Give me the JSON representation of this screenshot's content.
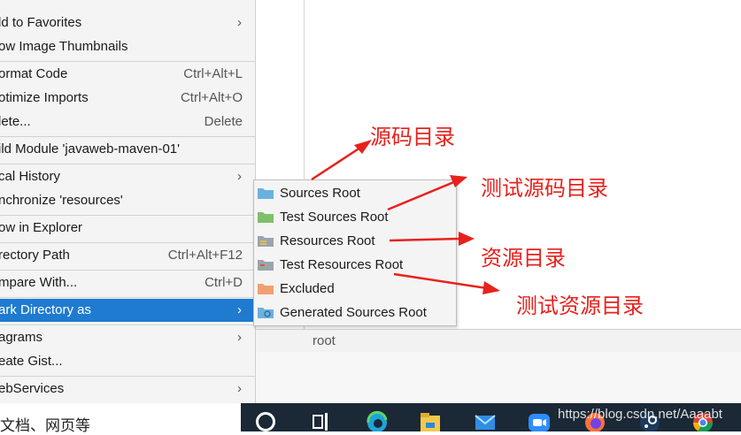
{
  "context_menu": {
    "items": [
      {
        "label": "uster",
        "shortcut": "",
        "submenu": false
      },
      {
        "label": "ld to Favorites",
        "shortcut": "",
        "submenu": true
      },
      {
        "label": "ow Image Thumbnails",
        "shortcut": "",
        "submenu": false
      },
      {
        "label": "ormat Code",
        "shortcut": "Ctrl+Alt+L",
        "submenu": false
      },
      {
        "label": "otimize Imports",
        "shortcut": "Ctrl+Alt+O",
        "submenu": false
      },
      {
        "label": "lete...",
        "shortcut": "Delete",
        "submenu": false
      },
      {
        "label": "ild Module 'javaweb-maven-01'",
        "shortcut": "",
        "submenu": false
      },
      {
        "label": "cal History",
        "shortcut": "",
        "submenu": true
      },
      {
        "label": "nchronize 'resources'",
        "shortcut": "",
        "submenu": false
      },
      {
        "label": "ow in Explorer",
        "shortcut": "",
        "submenu": false
      },
      {
        "label": "rectory Path",
        "shortcut": "Ctrl+Alt+F12",
        "submenu": false
      },
      {
        "label": "mpare With...",
        "shortcut": "Ctrl+D",
        "submenu": false
      },
      {
        "label": "ark Directory as",
        "shortcut": "",
        "submenu": true,
        "highlighted": true
      },
      {
        "label": "agrams",
        "shortcut": "",
        "submenu": true
      },
      {
        "label": "eate Gist...",
        "shortcut": "",
        "submenu": false
      },
      {
        "label": "ebServices",
        "shortcut": "",
        "submenu": true
      }
    ]
  },
  "submenu": {
    "items": [
      {
        "label": "Sources Root",
        "icon": "folder-blue-icon",
        "color": "#6bb1e0"
      },
      {
        "label": "Test Sources Root",
        "icon": "folder-green-icon",
        "color": "#7fbf6a"
      },
      {
        "label": "Resources Root",
        "icon": "folder-resources-icon",
        "color": "#9aa4b0"
      },
      {
        "label": "Test Resources Root",
        "icon": "folder-test-resources-icon",
        "color": "#9aa4b0"
      },
      {
        "label": "Excluded",
        "icon": "folder-orange-icon",
        "color": "#f0a070"
      },
      {
        "label": "Generated Sources Root",
        "icon": "folder-generated-icon",
        "color": "#6bb1e0"
      }
    ]
  },
  "status_strip": {
    "text": "root"
  },
  "bottom_left_text": "文档、网页等",
  "watermark": "https://blog.csdn.net/Aaaabt",
  "annotations": {
    "a1": "源码目录",
    "a2": "测试源码目录",
    "a3": "资源目录",
    "a4": "测试资源目录"
  },
  "taskbar": {
    "icons": [
      "search-icon",
      "task-view-icon",
      "edge-icon",
      "file-explorer-icon",
      "mail-icon",
      "zoom-icon",
      "firefox-icon",
      "steam-icon",
      "chrome-icon"
    ]
  },
  "colors": {
    "highlight": "#1f7bd0",
    "annotation": "#e8211c",
    "taskbar": "#1b2836"
  }
}
